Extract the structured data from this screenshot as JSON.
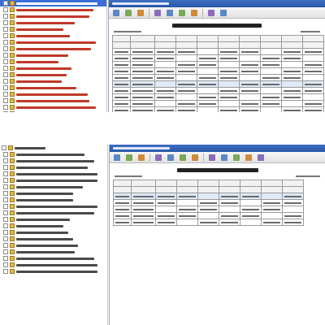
{
  "top": {
    "tree_items": [
      {
        "kind": "selected",
        "width": 100
      },
      {
        "kind": "red",
        "width": 95
      },
      {
        "kind": "red",
        "width": 90
      },
      {
        "kind": "red",
        "width": 72
      },
      {
        "kind": "red",
        "width": 58
      },
      {
        "kind": "red",
        "width": 66
      },
      {
        "kind": "red",
        "width": 98
      },
      {
        "kind": "red",
        "width": 92
      },
      {
        "kind": "red",
        "width": 64
      },
      {
        "kind": "red",
        "width": 52
      },
      {
        "kind": "red",
        "width": 68
      },
      {
        "kind": "red",
        "width": 62
      },
      {
        "kind": "red",
        "width": 56
      },
      {
        "kind": "red",
        "width": 74
      },
      {
        "kind": "red",
        "width": 88
      },
      {
        "kind": "red",
        "width": 90
      },
      {
        "kind": "red",
        "width": 98
      },
      {
        "kind": "plain",
        "width": 26
      }
    ],
    "toolbar_tools": 9,
    "table_cols": 10,
    "table_rows": 10,
    "highlight_row": 5
  },
  "bottom": {
    "tree_items": [
      {
        "kind": "root",
        "width": 38
      },
      {
        "kind": "plain",
        "width": 84
      },
      {
        "kind": "plain",
        "width": 96
      },
      {
        "kind": "plain",
        "width": 88
      },
      {
        "kind": "plain",
        "width": 100
      },
      {
        "kind": "plain",
        "width": 100
      },
      {
        "kind": "plain",
        "width": 82
      },
      {
        "kind": "plain",
        "width": 70
      },
      {
        "kind": "plain",
        "width": 70
      },
      {
        "kind": "plain",
        "width": 100
      },
      {
        "kind": "plain",
        "width": 96
      },
      {
        "kind": "plain",
        "width": 66
      },
      {
        "kind": "plain",
        "width": 58
      },
      {
        "kind": "plain",
        "width": 64
      },
      {
        "kind": "plain",
        "width": 70
      },
      {
        "kind": "plain",
        "width": 76
      },
      {
        "kind": "plain",
        "width": 72
      },
      {
        "kind": "plain",
        "width": 96
      },
      {
        "kind": "plain",
        "width": 100
      },
      {
        "kind": "plain",
        "width": 100
      }
    ],
    "toolbar_tools": 12,
    "table_cols": 9,
    "table_rows": 5,
    "highlight_row": 0
  }
}
